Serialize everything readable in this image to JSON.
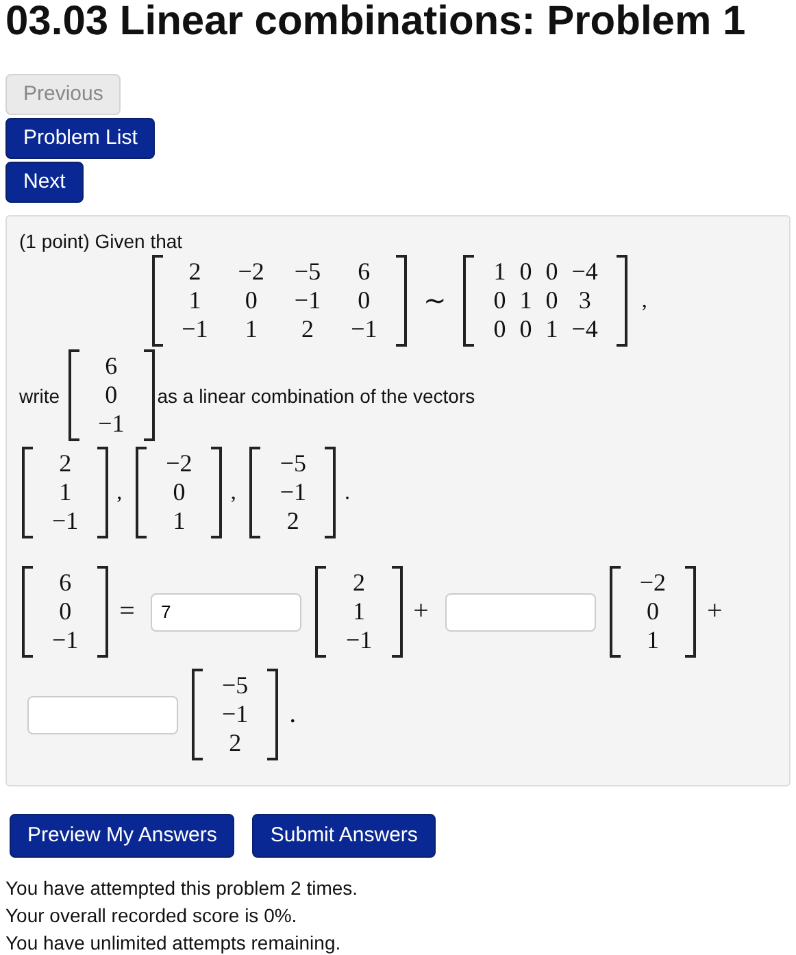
{
  "title": "03.03 Linear combinations: Problem 1",
  "nav_buttons": [
    {
      "label": "Previous",
      "disabled": true
    },
    {
      "label": "Problem List",
      "disabled": false
    },
    {
      "label": "Next",
      "disabled": false
    }
  ],
  "problem": {
    "intro": "(1 point) Given that",
    "matrix_a": [
      [
        "2",
        "−2",
        "−5",
        "6"
      ],
      [
        "1",
        "0",
        "−1",
        "0"
      ],
      [
        "−1",
        "1",
        "2",
        "−1"
      ]
    ],
    "relation": "∼",
    "matrix_b": [
      [
        "1",
        "0",
        "0",
        "−4"
      ],
      [
        "0",
        "1",
        "0",
        "3"
      ],
      [
        "0",
        "0",
        "1",
        "−4"
      ]
    ],
    "display_end": ",",
    "write_label": "write",
    "target": [
      "6",
      "0",
      "−1"
    ],
    "target_text": "as a linear combination of the vectors",
    "vectors": [
      {
        "entries": [
          "2",
          "1",
          "−1"
        ],
        "after": ","
      },
      {
        "entries": [
          "−2",
          "0",
          "1"
        ],
        "after": ","
      },
      {
        "entries": [
          "−5",
          "−1",
          "2"
        ],
        "after": "."
      }
    ],
    "equation": {
      "lhs": [
        "6",
        "0",
        "−1"
      ],
      "equals": "=",
      "terms": [
        {
          "value": "7",
          "vector": [
            "2",
            "1",
            "−1"
          ],
          "after": "+"
        },
        {
          "vector": [
            "−2",
            "0",
            "1"
          ],
          "after": "+"
        },
        {
          "vector": [
            "−5",
            "−1",
            "2"
          ],
          "after": "."
        }
      ]
    }
  },
  "action_buttons": [
    "Preview My Answers",
    "Submit Answers"
  ],
  "messages": [
    "You have attempted this problem 2 times.",
    "Your overall recorded score is 0%.",
    "You have unlimited attempts remaining."
  ]
}
